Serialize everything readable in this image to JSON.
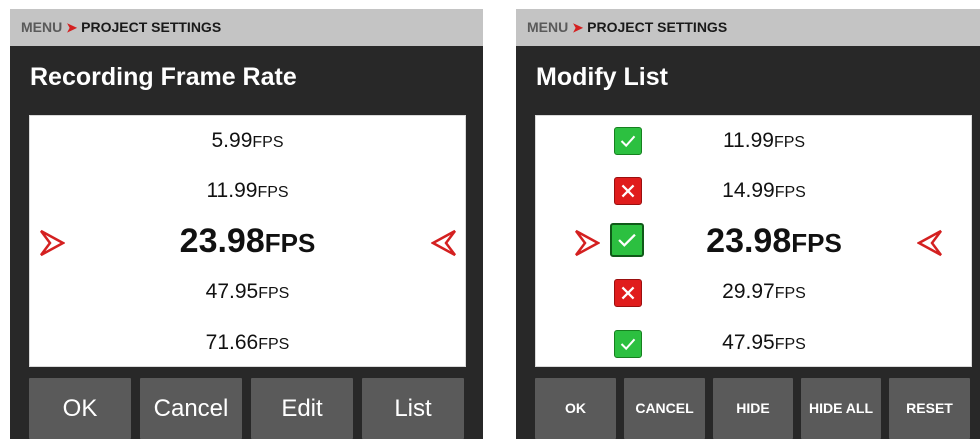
{
  "left": {
    "breadcrumb": {
      "menu": "MENU",
      "sep": "➤",
      "page": "PROJECT SETTINGS"
    },
    "title": "Recording Frame Rate",
    "rows": [
      {
        "value": "5.99",
        "unit": "FPS"
      },
      {
        "value": "11.99",
        "unit": "FPS"
      },
      {
        "value": "23.98",
        "unit": "FPS"
      },
      {
        "value": "47.95",
        "unit": "FPS"
      },
      {
        "value": "71.66",
        "unit": "FPS"
      }
    ],
    "buttons": [
      "OK",
      "Cancel",
      "Edit",
      "List"
    ]
  },
  "right": {
    "breadcrumb": {
      "menu": "MENU",
      "sep": "➤",
      "page": "PROJECT SETTINGS"
    },
    "title": "Modify List",
    "rows": [
      {
        "value": "11.99",
        "unit": "FPS",
        "enabled": true
      },
      {
        "value": "14.99",
        "unit": "FPS",
        "enabled": false
      },
      {
        "value": "23.98",
        "unit": "FPS",
        "enabled": true
      },
      {
        "value": "29.97",
        "unit": "FPS",
        "enabled": false
      },
      {
        "value": "47.95",
        "unit": "FPS",
        "enabled": true
      }
    ],
    "buttons": [
      "OK",
      "CANCEL",
      "HIDE",
      "HIDE ALL",
      "RESET"
    ]
  },
  "colors": {
    "accent": "#d42020",
    "check_on": "#2cc040",
    "check_off": "#e01c1c",
    "button": "#5a5a5a",
    "panel": "#282828"
  }
}
